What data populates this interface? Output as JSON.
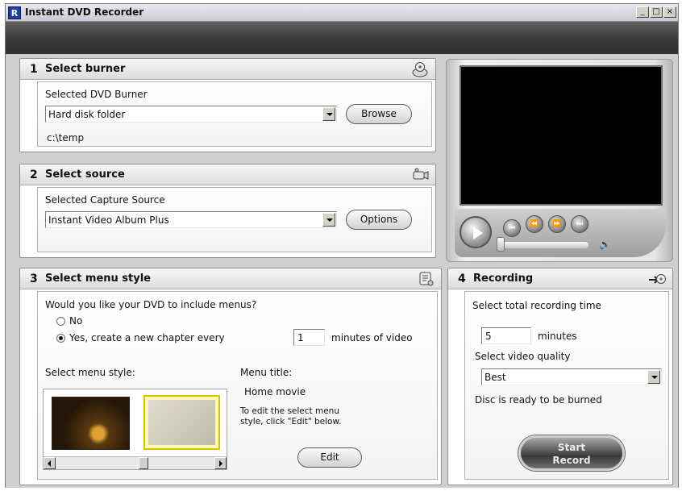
{
  "window": {
    "title": "Instant DVD Recorder",
    "icon_letter": "R",
    "controls": {
      "minimize": "_",
      "maximize": "□",
      "close": "×"
    }
  },
  "step1": {
    "number": "1",
    "title": "Select burner",
    "selected_label": "Selected DVD Burner",
    "burner_value": "Hard disk folder",
    "browse_label": "Browse",
    "path": "c:\\temp"
  },
  "step2": {
    "number": "2",
    "title": "Select source",
    "selected_label": "Selected Capture Source",
    "source_value": "Instant Video Album Plus",
    "options_label": "Options"
  },
  "step3": {
    "number": "3",
    "title": "Select menu style",
    "question": "Would you like your DVD to include menus?",
    "option_no": "No",
    "option_yes": "Yes, create a new chapter every",
    "chapter_minutes": "1",
    "minutes_suffix": "minutes of video",
    "style_label": "Select menu style:",
    "menu_title_label": "Menu title:",
    "menu_title_value": "Home movie",
    "edit_hint": "To edit the select menu style, click \"Edit\" below.",
    "edit_label": "Edit",
    "selected_option": "yes"
  },
  "step4": {
    "number": "4",
    "title": "Recording",
    "time_label": "Select total recording time",
    "time_value": "5",
    "time_unit": "minutes",
    "quality_label": "Select video quality",
    "quality_value": "Best",
    "status": "Disc is ready to be burned",
    "record_line1": "Start",
    "record_line2": "Record"
  },
  "player": {
    "controls": [
      "play",
      "previous",
      "rewind",
      "fast-forward",
      "next"
    ],
    "volume_level": 0.0
  }
}
